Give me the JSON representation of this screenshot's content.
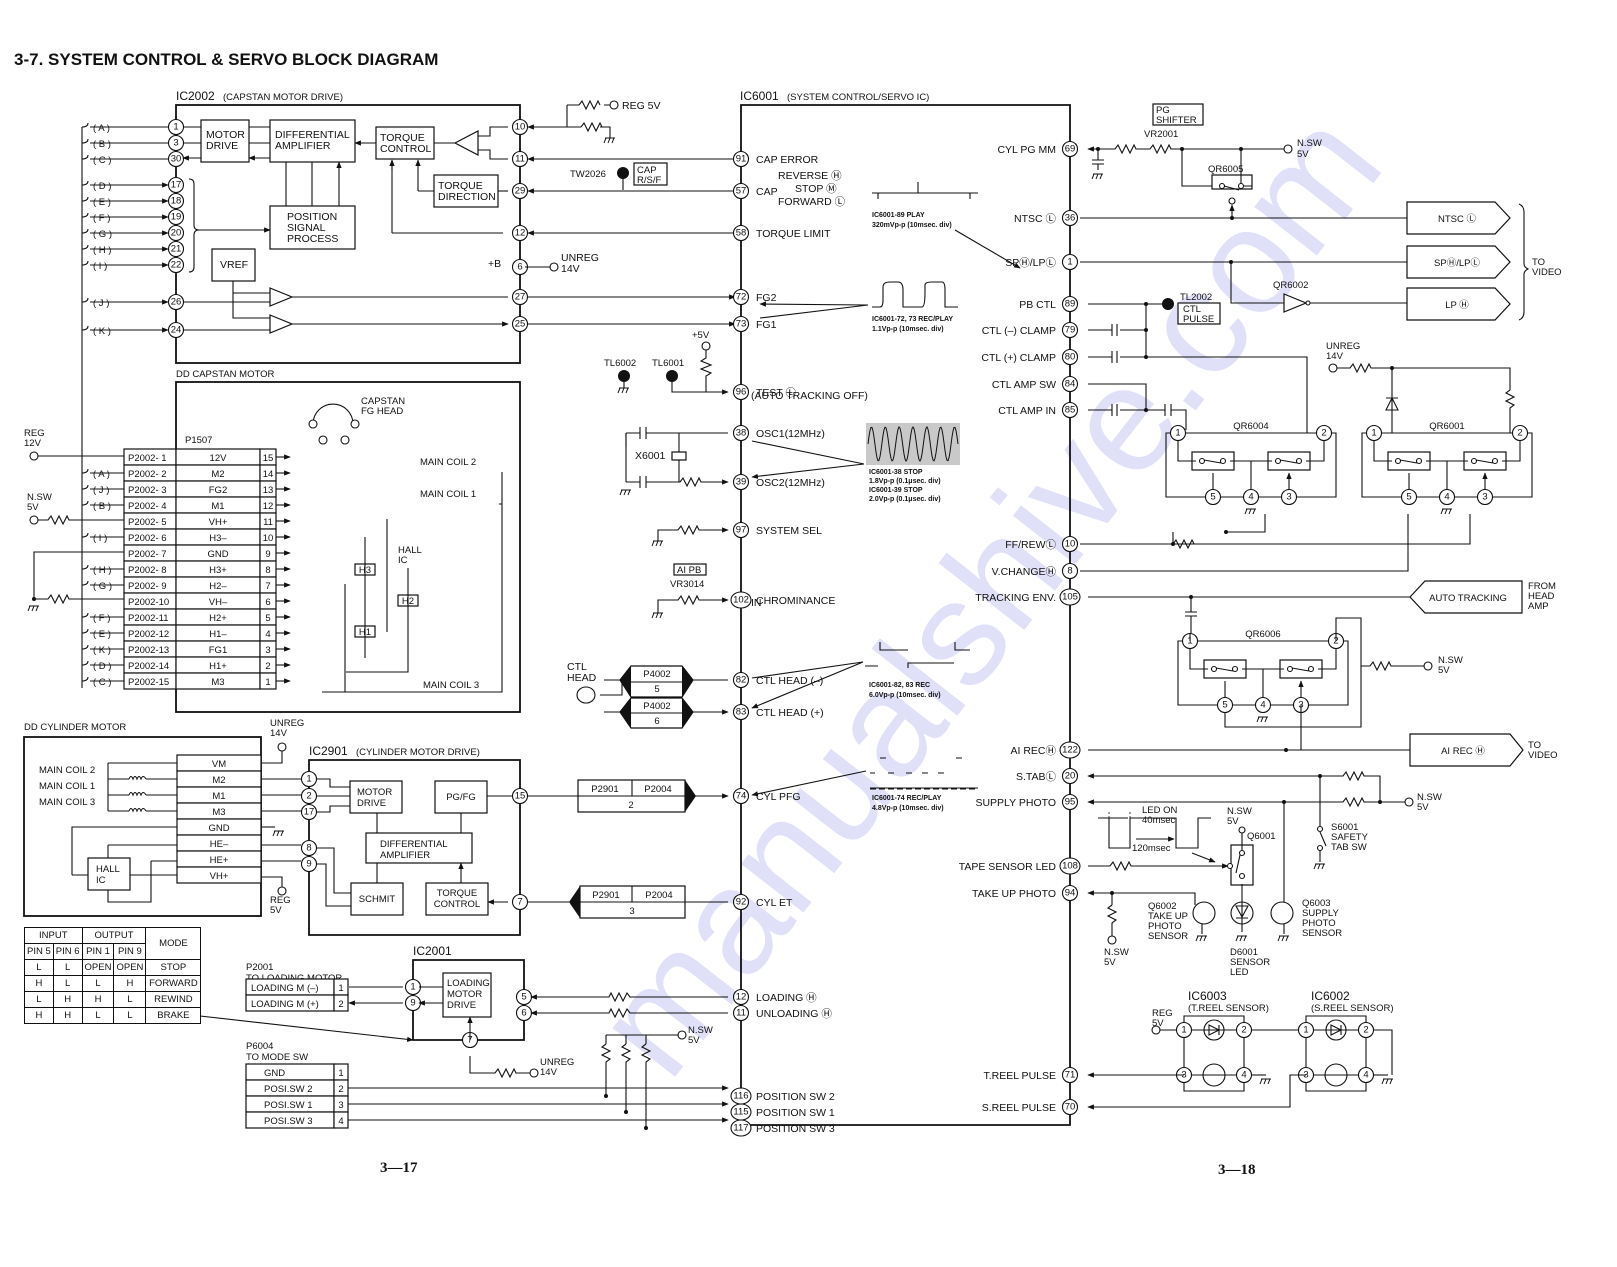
{
  "title": "3-7. SYSTEM CONTROL & SERVO BLOCK DIAGRAM",
  "page_numbers": {
    "left": "3—17",
    "right": "3—18"
  },
  "ic2002": {
    "name": "IC2002",
    "desc": "(CAPSTAN MOTOR DRIVE)",
    "blocks": {
      "motor_drive": [
        "MOTOR",
        "DRIVE"
      ],
      "diff_amp": [
        "DIFFERENTIAL",
        "AMPLIFIER"
      ],
      "torque_control": [
        "TORQUE",
        "CONTROL"
      ],
      "torque_direction": [
        "TORQUE",
        "DIRECTION"
      ],
      "position": [
        "POSITION",
        "SIGNAL",
        "PROCESS"
      ],
      "vref": "VREF"
    },
    "left_pins": [
      {
        "sig": "A",
        "pin": "1"
      },
      {
        "sig": "B",
        "pin": "3"
      },
      {
        "sig": "C",
        "pin": "30"
      },
      {
        "sig": "D",
        "pin": "17"
      },
      {
        "sig": "E",
        "pin": "18"
      },
      {
        "sig": "F",
        "pin": "19"
      },
      {
        "sig": "G",
        "pin": "20"
      },
      {
        "sig": "H",
        "pin": "21"
      },
      {
        "sig": "I",
        "pin": "22"
      },
      {
        "sig": "J",
        "pin": "26"
      },
      {
        "sig": "K",
        "pin": "24"
      }
    ],
    "right_pins": [
      "10",
      "11",
      "29",
      "12",
      "6",
      "27",
      "25"
    ],
    "plus_b": "+B",
    "reg5v": "REG 5V",
    "unreg": [
      "UNREG",
      "14V"
    ],
    "tw2026": "TW2026",
    "cap_rsf": [
      "CAP",
      "R/S/F"
    ]
  },
  "capstan_motor": {
    "title": "DD CAPSTAN MOTOR",
    "connector": "P1507",
    "fg_head": [
      "CAPSTAN",
      "FG HEAD"
    ],
    "hall_ic": [
      "HALL",
      "IC"
    ],
    "coils": [
      "MAIN COIL 2",
      "MAIN COIL 1",
      "MAIN COIL 3"
    ],
    "hall": [
      "H3",
      "H2",
      "H1"
    ],
    "reg12": [
      "REG",
      "12V"
    ],
    "nsw5": [
      "N.SW",
      "5V"
    ],
    "rows": [
      {
        "sig": "",
        "p2002": "P2002- 1",
        "name": "12V",
        "pin": "15"
      },
      {
        "sig": "A",
        "p2002": "P2002- 2",
        "name": "M2",
        "pin": "14"
      },
      {
        "sig": "J",
        "p2002": "P2002- 3",
        "name": "FG2",
        "pin": "13"
      },
      {
        "sig": "B",
        "p2002": "P2002- 4",
        "name": "M1",
        "pin": "12"
      },
      {
        "sig": "",
        "p2002": "P2002- 5",
        "name": "VH+",
        "pin": "11"
      },
      {
        "sig": "I",
        "p2002": "P2002- 6",
        "name": "H3–",
        "pin": "10"
      },
      {
        "sig": "",
        "p2002": "P2002- 7",
        "name": "GND",
        "pin": "9"
      },
      {
        "sig": "H",
        "p2002": "P2002- 8",
        "name": "H3+",
        "pin": "8"
      },
      {
        "sig": "G",
        "p2002": "P2002- 9",
        "name": "H2–",
        "pin": "7"
      },
      {
        "sig": "",
        "p2002": "P2002-10",
        "name": "VH–",
        "pin": "6"
      },
      {
        "sig": "F",
        "p2002": "P2002-11",
        "name": "H2+",
        "pin": "5"
      },
      {
        "sig": "E",
        "p2002": "P2002-12",
        "name": "H1–",
        "pin": "4"
      },
      {
        "sig": "K",
        "p2002": "P2002-13",
        "name": "FG1",
        "pin": "3"
      },
      {
        "sig": "D",
        "p2002": "P2002-14",
        "name": "H1+",
        "pin": "2"
      },
      {
        "sig": "C",
        "p2002": "P2002-15",
        "name": "M3",
        "pin": "1"
      }
    ]
  },
  "cylinder_motor": {
    "title": "DD CYLINDER MOTOR",
    "coils": [
      "MAIN COIL 2",
      "MAIN COIL 1",
      "MAIN COIL 3"
    ],
    "hall_ic": [
      "HALL",
      "IC"
    ],
    "rows": [
      "VM",
      "M2",
      "M1",
      "M3",
      "GND",
      "HE–",
      "HE+",
      "VH+"
    ],
    "unreg": [
      "UNREG",
      "14V"
    ],
    "reg": [
      "REG",
      "5V"
    ]
  },
  "ic2901": {
    "name": "IC2901",
    "desc": "(CYLINDER MOTOR DRIVE)",
    "pins": [
      "1",
      "2",
      "17",
      "8",
      "9",
      "15",
      "7"
    ],
    "blocks": {
      "motor_drive": [
        "MOTOR",
        "DRIVE"
      ],
      "pgfg": "PG/FG",
      "diff_amp": [
        "DIFFERENTIAL",
        "AMPLIFIER"
      ],
      "schmit": "SCHMIT",
      "torque": [
        "TORQUE",
        "CONTROL"
      ]
    }
  },
  "connectors": {
    "p4002_5": [
      "P4002",
      "5"
    ],
    "p4002_6": [
      "P4002",
      "6"
    ],
    "p2901_2": [
      "P2901",
      "P2004",
      "2"
    ],
    "p2901_3": [
      "P2901",
      "P2004",
      "3"
    ],
    "ctl_head": [
      "CTL",
      "HEAD"
    ]
  },
  "ic2001": {
    "name": "IC2001",
    "block": [
      "LOADING",
      "MOTOR",
      "DRIVE"
    ],
    "pins": [
      "1",
      "9",
      "5",
      "6",
      "7"
    ],
    "p2001": [
      "P2001",
      "TO LOADING MOTOR"
    ],
    "p2001_rows": [
      {
        "label": "LOADING M (–)",
        "pin": "1"
      },
      {
        "label": "LOADING M (+)",
        "pin": "2"
      }
    ],
    "p6004": [
      "P6004",
      "TO MODE SW"
    ],
    "p6004_rows": [
      {
        "label": "GND",
        "pin": "1"
      },
      {
        "label": "POSI.SW 2",
        "pin": "2"
      },
      {
        "label": "POSI.SW 1",
        "pin": "3"
      },
      {
        "label": "POSI.SW 3",
        "pin": "4"
      }
    ],
    "unreg": [
      "UNREG",
      "14V"
    ],
    "nsw": [
      "N.SW",
      "5V"
    ]
  },
  "mode_table": {
    "header_top": [
      "INPUT",
      "OUTPUT",
      "MODE"
    ],
    "header_pins": [
      "PIN 5",
      "PIN 6",
      "PIN 1",
      "PIN 9"
    ],
    "rows": [
      [
        "L",
        "L",
        "OPEN",
        "OPEN",
        "STOP"
      ],
      [
        "H",
        "L",
        "L",
        "H",
        "FORWARD"
      ],
      [
        "L",
        "H",
        "H",
        "L",
        "REWIND"
      ],
      [
        "H",
        "H",
        "L",
        "L",
        "BRAKE"
      ]
    ]
  },
  "ic6001": {
    "name": "IC6001",
    "desc": "(SYSTEM CONTROL/SERVO IC)",
    "left_pins": [
      {
        "pin": "91",
        "label": "CAP ERROR"
      },
      {
        "pin": "57",
        "label": "CAP"
      },
      {
        "pin": "58",
        "label": "TORQUE LIMIT"
      },
      {
        "pin": "72",
        "label": "FG2"
      },
      {
        "pin": "73",
        "label": "FG1"
      },
      {
        "pin": "96",
        "label": "TEST Ⓛ"
      },
      {
        "pin": "38",
        "label": "OSC1(12MHz)"
      },
      {
        "pin": "39",
        "label": "OSC2(12MHz)"
      },
      {
        "pin": "97",
        "label": "SYSTEM SEL"
      },
      {
        "pin": "102",
        "label": "CHROMINANCE"
      },
      {
        "pin": "82",
        "label": "CTL HEAD (–)"
      },
      {
        "pin": "83",
        "label": "CTL HEAD (+)"
      },
      {
        "pin": "74",
        "label": "CYL PFG"
      },
      {
        "pin": "92",
        "label": "CYL ET"
      },
      {
        "pin": "12",
        "label": "LOADING Ⓗ"
      },
      {
        "pin": "11",
        "label": "UNLOADING Ⓗ"
      },
      {
        "pin": "116",
        "label": "POSITION SW 2"
      },
      {
        "pin": "115",
        "label": "POSITION SW 1"
      },
      {
        "pin": "117",
        "label": "POSITION SW 3"
      }
    ],
    "cap_modes": [
      "REVERSE Ⓗ",
      "STOP Ⓜ",
      "FORWARD Ⓛ"
    ],
    "test_sub": "(AUTO TRACKING OFF)",
    "chroma_sub": "IN",
    "right_pins": [
      {
        "pin": "69",
        "label": "CYL PG MM"
      },
      {
        "pin": "36",
        "label": "NTSC Ⓛ"
      },
      {
        "pin": "1",
        "label": "SPⒽ/LPⓁ"
      },
      {
        "pin": "89",
        "label": "PB CTL"
      },
      {
        "pin": "79",
        "label": "CTL (–) CLAMP"
      },
      {
        "pin": "80",
        "label": "CTL (+) CLAMP"
      },
      {
        "pin": "84",
        "label": "CTL AMP SW"
      },
      {
        "pin": "85",
        "label": "CTL AMP IN"
      },
      {
        "pin": "10",
        "label": "FF/REWⓁ"
      },
      {
        "pin": "8",
        "label": "V.CHANGEⒽ"
      },
      {
        "pin": "105",
        "label": "TRACKING ENV."
      },
      {
        "pin": "122",
        "label": "AI RECⒽ"
      },
      {
        "pin": "20",
        "label": "S.TABⓁ"
      },
      {
        "pin": "95",
        "label": "SUPPLY PHOTO"
      },
      {
        "pin": "108",
        "label": "TAPE SENSOR LED"
      },
      {
        "pin": "94",
        "label": "TAKE UP PHOTO"
      },
      {
        "pin": "71",
        "label": "T.REEL PULSE"
      },
      {
        "pin": "70",
        "label": "S.REEL PULSE"
      }
    ]
  },
  "misc_left": {
    "tl6002": "TL6002",
    "tl6001": "TL6001",
    "plus5v": "+5V",
    "x6001": "X6001",
    "ai_pb": "AI PB",
    "vr3014": "VR3014"
  },
  "waveforms": [
    {
      "id": "w89",
      "line1": "IC6001-89  PLAY",
      "line2": "320mVp-p (10msec. div)"
    },
    {
      "id": "w7273",
      "line1": "IC6001-72, 73  REC/PLAY",
      "line2": "1.1Vp-p (10msec. div)"
    },
    {
      "id": "wosc",
      "line1": "IC6001-38  STOP",
      "line2": "1.8Vp-p (0.1μsec. div)",
      "line3": "IC6001-39  STOP",
      "line4": "2.0Vp-p (0.1μsec. div)"
    },
    {
      "id": "w8283",
      "line1": "IC6001-82, 83  REC",
      "line2": "6.0Vp-p (10msec. div)"
    },
    {
      "id": "w74",
      "line1": "IC6001-74  REC/PLAY",
      "line2": "4.8Vp-p (10msec. div)"
    }
  ],
  "right_side": {
    "pg_shifter": [
      "PG",
      "SHIFTER"
    ],
    "vr2001": "VR2001",
    "nsw5": [
      "N.SW",
      "5V"
    ],
    "qr6005": "QR6005",
    "qr6002": "QR6002",
    "tl2002": "TL2002",
    "ctl_pulse": [
      "CTL",
      "PULSE"
    ],
    "to_video_boxes": [
      "NTSC Ⓛ",
      "SPⒽ/LPⓁ",
      "LP Ⓗ"
    ],
    "to_video": [
      "TO",
      "VIDEO"
    ],
    "unreg": [
      "UNREG",
      "14V"
    ],
    "qr6004": "QR6004",
    "qr6001": "QR6001",
    "qr6006": "QR6006",
    "qr_pins": [
      "1",
      "2",
      "5",
      "4",
      "3"
    ],
    "auto_tracking": "AUTO TRACKING",
    "from_head_amp": [
      "FROM",
      "HEAD",
      "AMP"
    ],
    "ai_rec": "AI REC Ⓗ",
    "led_on": [
      "LED ON",
      "40msec"
    ],
    "t120": "120msec",
    "q6001": "Q6001",
    "s6001": [
      "S6001",
      "SAFETY",
      "TAB SW"
    ],
    "q6002": [
      "Q6002",
      "TAKE UP",
      "PHOTO",
      "SENSOR"
    ],
    "q6003": [
      "Q6003",
      "SUPPLY",
      "PHOTO",
      "SENSOR"
    ],
    "d6001": [
      "D6001",
      "SENSOR",
      "LED"
    ],
    "ic6003": [
      "IC6003",
      "(T.REEL SENSOR)"
    ],
    "ic6002": [
      "IC6002",
      "(S.REEL SENSOR)"
    ],
    "reg5v": [
      "REG",
      "5V"
    ],
    "reel_pins": [
      "1",
      "2",
      "3",
      "4"
    ]
  },
  "watermark": "manualshive.com"
}
